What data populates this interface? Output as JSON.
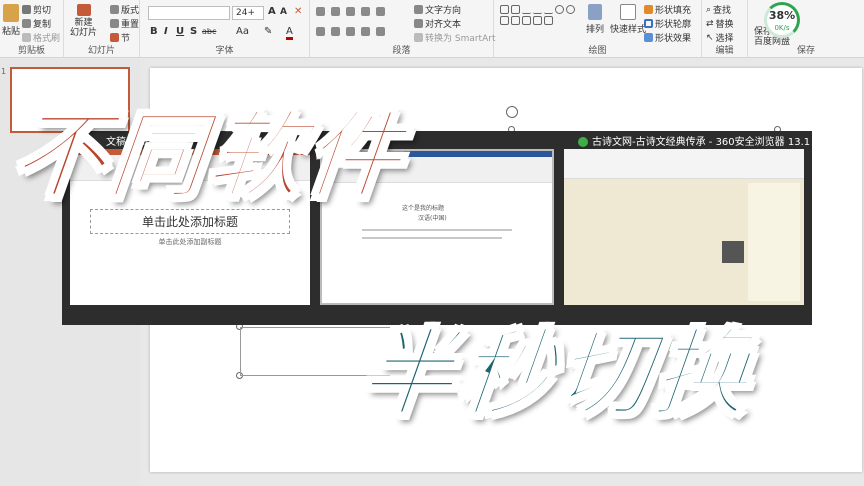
{
  "ribbon": {
    "clipboard": {
      "paste": "粘贴",
      "cut": "剪切",
      "copy": "复制",
      "format_painter": "格式刷",
      "label": "剪贴板"
    },
    "slides": {
      "new_slide": "新建\n幻灯片",
      "layout": "版式",
      "reset": "重置",
      "section": "节",
      "label": "幻灯片"
    },
    "font": {
      "size": "24+",
      "bold": "B",
      "italic": "I",
      "underline": "U",
      "strike": "S",
      "shadow": "abc",
      "aa": "Aa",
      "label": "字体"
    },
    "paragraph": {
      "text_direction": "文字方向",
      "align_text": "对齐文本",
      "smartart": "转换为 SmartArt",
      "label": "段落"
    },
    "drawing": {
      "arrange": "排列",
      "quick_styles": "快速样式",
      "shape_fill": "形状填充",
      "shape_outline": "形状轮廓",
      "shape_effects": "形状效果",
      "label": "绘图"
    },
    "editing": {
      "find": "查找",
      "replace": "替换",
      "select": "选择",
      "label": "编辑"
    },
    "save": {
      "save": "保存",
      "baidu": "百度网盘",
      "label": "保存"
    },
    "progress": {
      "value": "38%",
      "speed": "0K/s"
    }
  },
  "thumbnail": {
    "number": "1"
  },
  "switcher": {
    "windows": [
      {
        "title": "文稿1 - Po",
        "placeholder_title": "单击此处添加标题",
        "placeholder_sub": "单击此处添加副标题"
      },
      {
        "title": "性格",
        "doc_heading": "这个是我的标题",
        "doc_sub": "汉语(中国)"
      },
      {
        "title": "古诗文网-古诗文经典传承 - 360安全浏览器 13.1"
      }
    ]
  },
  "overlay": {
    "line1": "不同软件",
    "line2": "半秒切换"
  },
  "colors": {
    "accent_red": "#b9432b",
    "accent_teal": "#1d6272",
    "ppt_red": "#c55a3a",
    "word_blue": "#2b579a"
  }
}
